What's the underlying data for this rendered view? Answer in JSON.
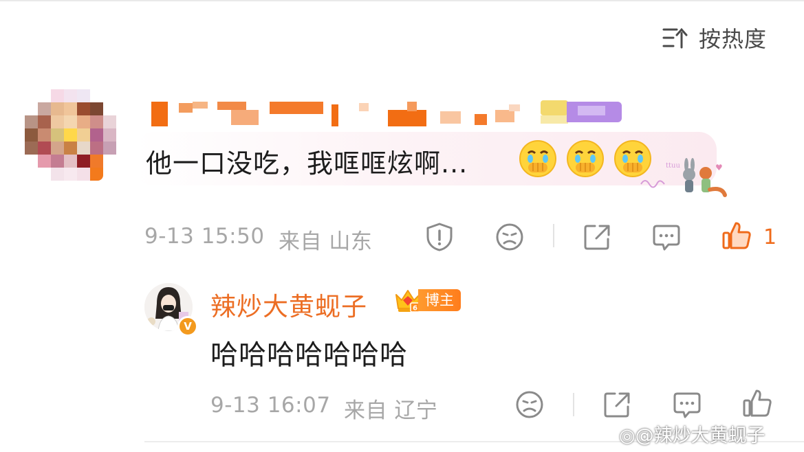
{
  "sort": {
    "label": "按热度"
  },
  "comment": {
    "text": "他一口没吃，我哐哐炫啊...",
    "emojis": [
      "crying-face-emoji",
      "crying-face-emoji",
      "crying-face-emoji"
    ],
    "timestamp": "9-13 15:50",
    "source": "来自 山东",
    "like_count": "1"
  },
  "reply": {
    "username": "辣炒大黄蚬子",
    "badge": "博主",
    "text": "哈哈哈哈哈哈哈",
    "timestamp": "9-13 16:07",
    "source": "来自 辽宁"
  },
  "watermark": "@辣炒大黄蚬子",
  "colors": {
    "accent": "#ef6a1a",
    "meta_gray": "#a7a7a7",
    "bubble_pink": "#fbeaf0"
  }
}
